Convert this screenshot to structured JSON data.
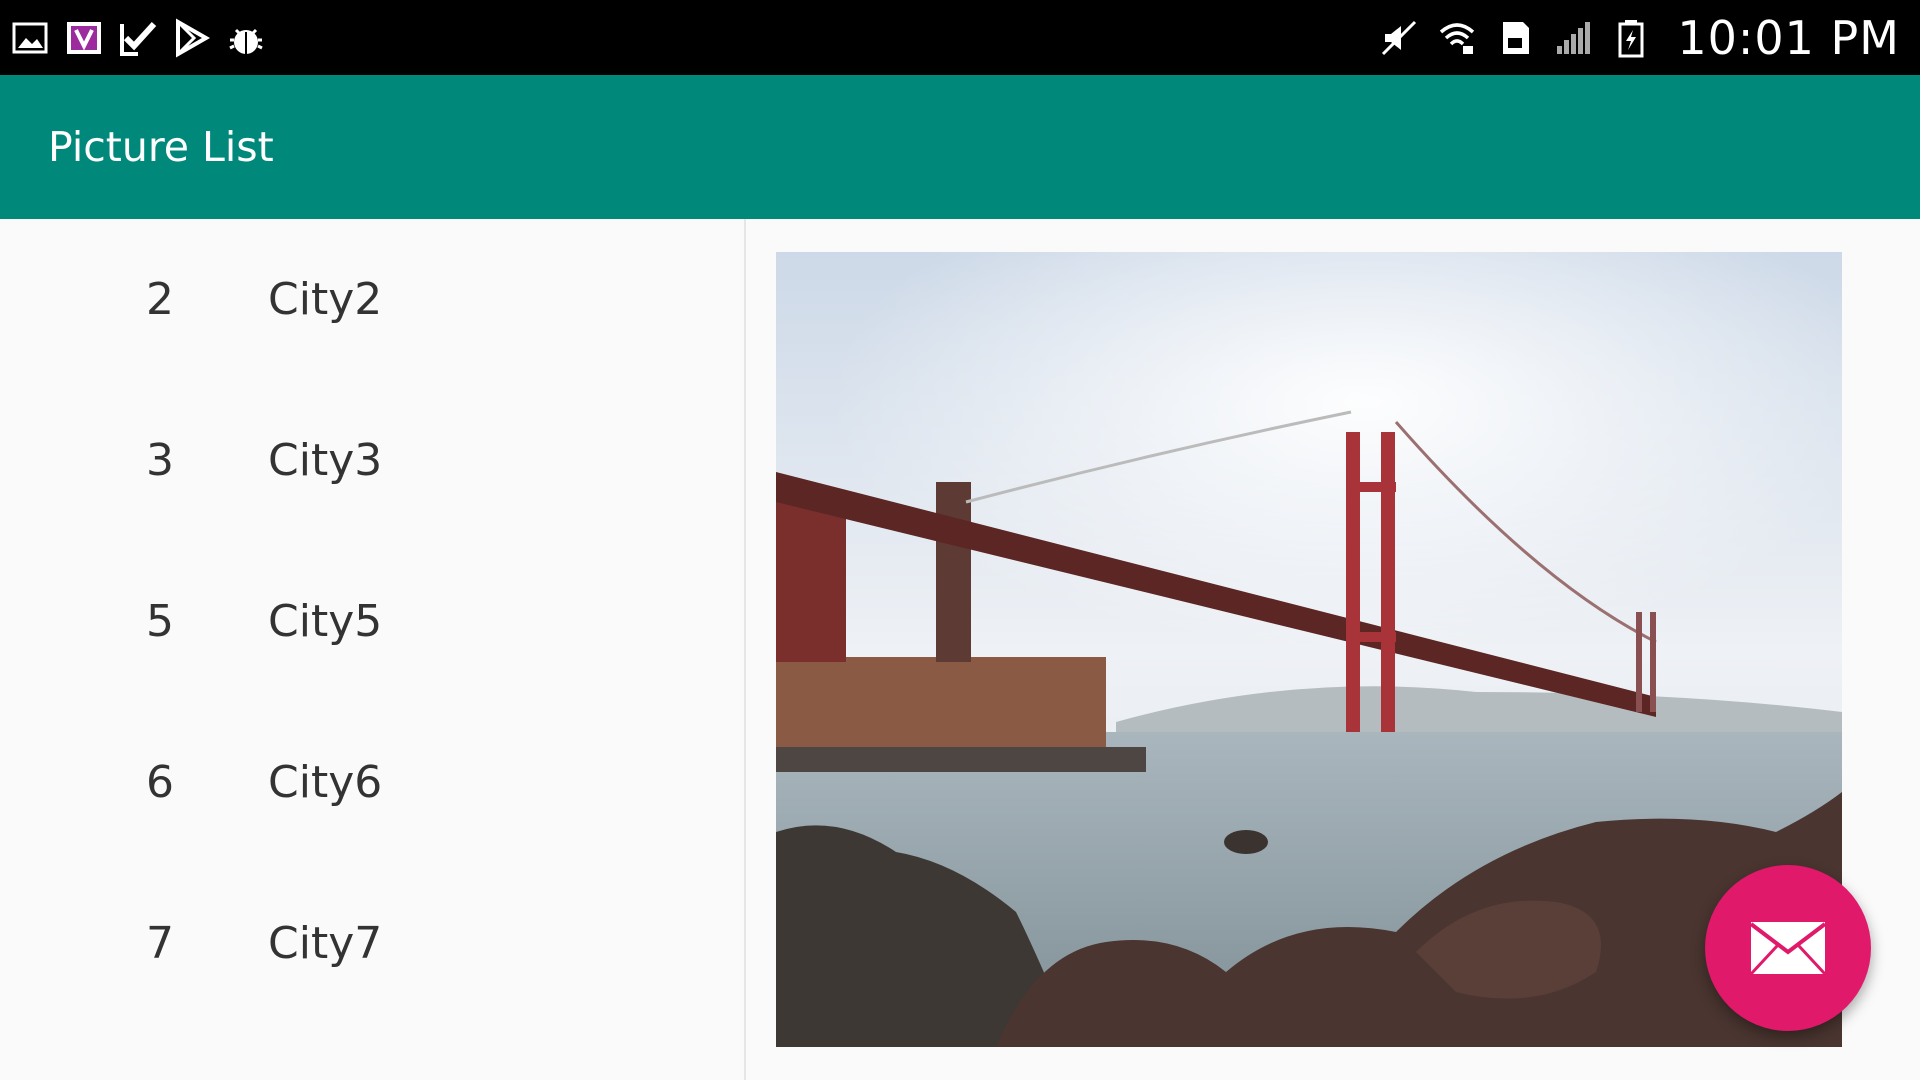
{
  "status_bar": {
    "left_icons": [
      "gallery-icon",
      "v-app-icon",
      "checkmark-icon",
      "play-store-icon",
      "android-debug-icon"
    ],
    "right_icons": [
      "mute-icon",
      "wifi-icon",
      "sd-card-icon",
      "signal-icon",
      "battery-icon"
    ],
    "time": "10:01 PM"
  },
  "app_bar": {
    "title": "Picture List"
  },
  "list": {
    "items": [
      {
        "number": "2",
        "name": "City2"
      },
      {
        "number": "3",
        "name": "City3"
      },
      {
        "number": "5",
        "name": "City5"
      },
      {
        "number": "6",
        "name": "City6"
      },
      {
        "number": "7",
        "name": "City7"
      }
    ]
  },
  "detail": {
    "image_icon": "city-photo"
  },
  "fab": {
    "icon": "mail-icon"
  },
  "colors": {
    "app_bar": "#00897b",
    "fab": "#e0196a",
    "status_bar": "#000000",
    "background": "#fafafa"
  }
}
